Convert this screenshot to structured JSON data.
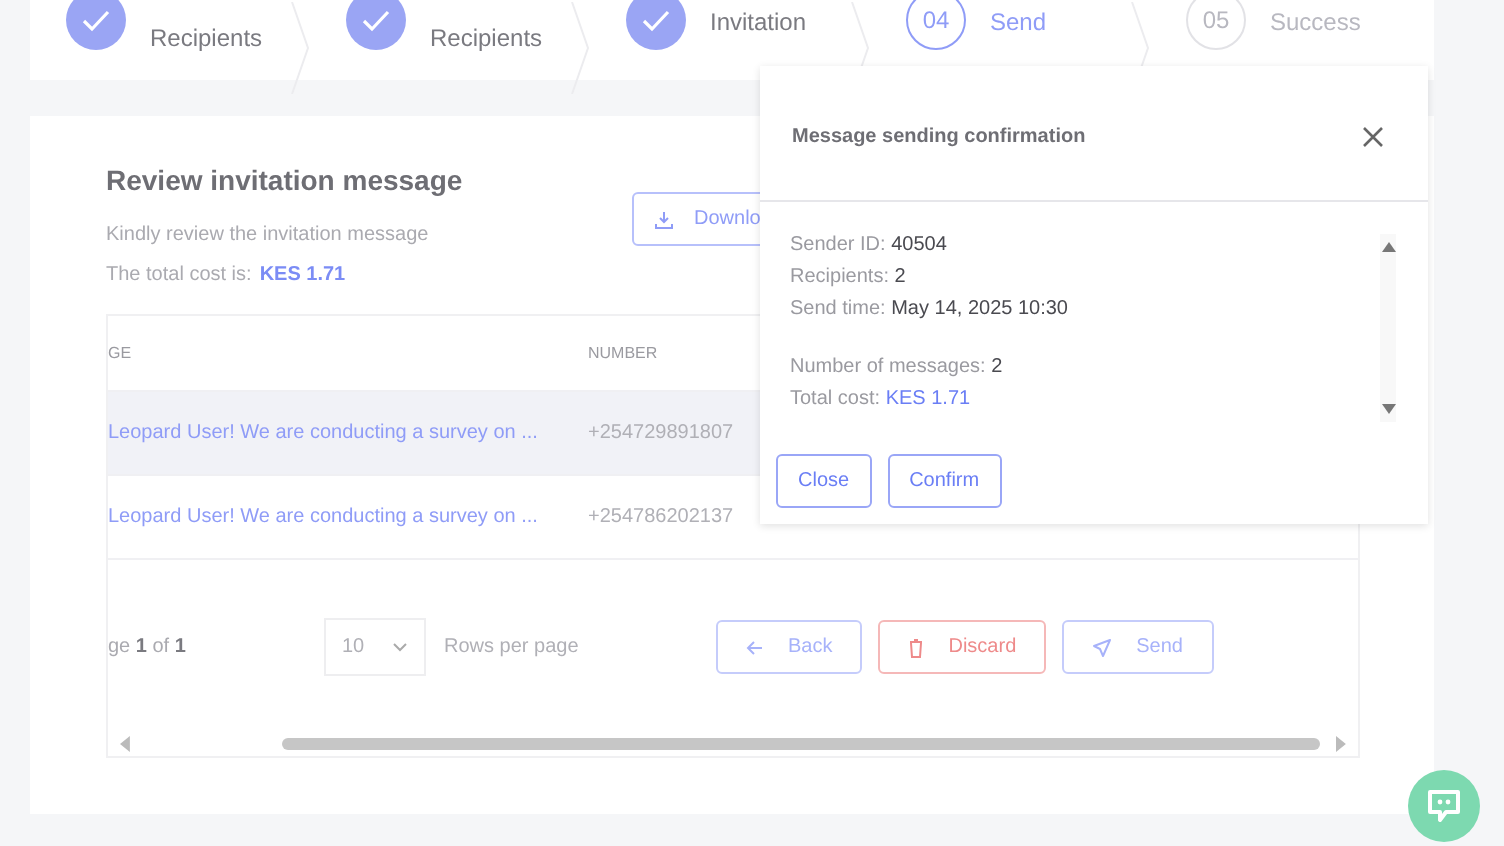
{
  "steps": [
    {
      "label": "Recipients",
      "completed": true,
      "current": false
    },
    {
      "label": "Recipients",
      "completed": true,
      "current": false
    },
    {
      "label": "Invitation",
      "completed": true,
      "current": false
    },
    {
      "number": "04",
      "label": "Send",
      "completed": false,
      "current": true
    },
    {
      "number": "05",
      "label": "Success",
      "completed": false,
      "current": false
    }
  ],
  "review": {
    "title": "Review invitation message",
    "subtitle": "Kindly review the invitation message",
    "cost_label": "The total cost is:",
    "cost_value": "KES 1.71",
    "download_button": "Downlo"
  },
  "table": {
    "columns": [
      "GE",
      "NUMBER"
    ],
    "rows": [
      {
        "message": "Leopard User! We are conducting a survey on ...",
        "number": "+254729891807",
        "selected": true
      },
      {
        "message": "Leopard User! We are conducting a survey on ...",
        "number": "+254786202137",
        "selected": false
      }
    ]
  },
  "pagination": {
    "page_text": "ge **1** of **1**",
    "rows_per_page_value": "10",
    "rows_per_page_label": "Rows per page"
  },
  "actions": [
    {
      "kind": "back",
      "label": "Back"
    },
    {
      "kind": "discard",
      "label": "Discard"
    },
    {
      "kind": "send",
      "label": "Send"
    }
  ],
  "dialog": {
    "title": "Message sending confirmation",
    "detail_groups": [
      [
        {
          "label": "Sender ID:",
          "value": "40504",
          "kind": "plain"
        },
        {
          "label": "Recipients:",
          "value": "2",
          "kind": "plain"
        },
        {
          "label": "Send time:",
          "value": "May 14, 2025 10:30",
          "kind": "plain"
        }
      ],
      [
        {
          "label": "Number of messages:",
          "value": "2",
          "kind": "plain"
        },
        {
          "label": "Total cost:",
          "value": "KES 1.71",
          "kind": "link"
        }
      ]
    ],
    "buttons": [
      "Close",
      "Confirm"
    ]
  }
}
